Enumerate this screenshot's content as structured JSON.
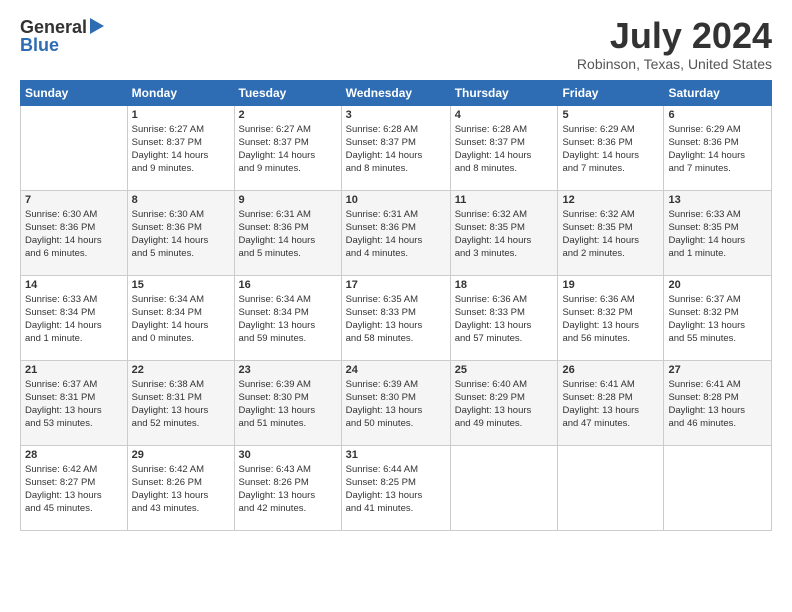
{
  "header": {
    "logo_general": "General",
    "logo_blue": "Blue",
    "month_title": "July 2024",
    "location": "Robinson, Texas, United States"
  },
  "calendar": {
    "columns": [
      "Sunday",
      "Monday",
      "Tuesday",
      "Wednesday",
      "Thursday",
      "Friday",
      "Saturday"
    ],
    "weeks": [
      [
        {
          "num": "",
          "info": ""
        },
        {
          "num": "1",
          "info": "Sunrise: 6:27 AM\nSunset: 8:37 PM\nDaylight: 14 hours\nand 9 minutes."
        },
        {
          "num": "2",
          "info": "Sunrise: 6:27 AM\nSunset: 8:37 PM\nDaylight: 14 hours\nand 9 minutes."
        },
        {
          "num": "3",
          "info": "Sunrise: 6:28 AM\nSunset: 8:37 PM\nDaylight: 14 hours\nand 8 minutes."
        },
        {
          "num": "4",
          "info": "Sunrise: 6:28 AM\nSunset: 8:37 PM\nDaylight: 14 hours\nand 8 minutes."
        },
        {
          "num": "5",
          "info": "Sunrise: 6:29 AM\nSunset: 8:36 PM\nDaylight: 14 hours\nand 7 minutes."
        },
        {
          "num": "6",
          "info": "Sunrise: 6:29 AM\nSunset: 8:36 PM\nDaylight: 14 hours\nand 7 minutes."
        }
      ],
      [
        {
          "num": "7",
          "info": "Sunrise: 6:30 AM\nSunset: 8:36 PM\nDaylight: 14 hours\nand 6 minutes."
        },
        {
          "num": "8",
          "info": "Sunrise: 6:30 AM\nSunset: 8:36 PM\nDaylight: 14 hours\nand 5 minutes."
        },
        {
          "num": "9",
          "info": "Sunrise: 6:31 AM\nSunset: 8:36 PM\nDaylight: 14 hours\nand 5 minutes."
        },
        {
          "num": "10",
          "info": "Sunrise: 6:31 AM\nSunset: 8:36 PM\nDaylight: 14 hours\nand 4 minutes."
        },
        {
          "num": "11",
          "info": "Sunrise: 6:32 AM\nSunset: 8:35 PM\nDaylight: 14 hours\nand 3 minutes."
        },
        {
          "num": "12",
          "info": "Sunrise: 6:32 AM\nSunset: 8:35 PM\nDaylight: 14 hours\nand 2 minutes."
        },
        {
          "num": "13",
          "info": "Sunrise: 6:33 AM\nSunset: 8:35 PM\nDaylight: 14 hours\nand 1 minute."
        }
      ],
      [
        {
          "num": "14",
          "info": "Sunrise: 6:33 AM\nSunset: 8:34 PM\nDaylight: 14 hours\nand 1 minute."
        },
        {
          "num": "15",
          "info": "Sunrise: 6:34 AM\nSunset: 8:34 PM\nDaylight: 14 hours\nand 0 minutes."
        },
        {
          "num": "16",
          "info": "Sunrise: 6:34 AM\nSunset: 8:34 PM\nDaylight: 13 hours\nand 59 minutes."
        },
        {
          "num": "17",
          "info": "Sunrise: 6:35 AM\nSunset: 8:33 PM\nDaylight: 13 hours\nand 58 minutes."
        },
        {
          "num": "18",
          "info": "Sunrise: 6:36 AM\nSunset: 8:33 PM\nDaylight: 13 hours\nand 57 minutes."
        },
        {
          "num": "19",
          "info": "Sunrise: 6:36 AM\nSunset: 8:32 PM\nDaylight: 13 hours\nand 56 minutes."
        },
        {
          "num": "20",
          "info": "Sunrise: 6:37 AM\nSunset: 8:32 PM\nDaylight: 13 hours\nand 55 minutes."
        }
      ],
      [
        {
          "num": "21",
          "info": "Sunrise: 6:37 AM\nSunset: 8:31 PM\nDaylight: 13 hours\nand 53 minutes."
        },
        {
          "num": "22",
          "info": "Sunrise: 6:38 AM\nSunset: 8:31 PM\nDaylight: 13 hours\nand 52 minutes."
        },
        {
          "num": "23",
          "info": "Sunrise: 6:39 AM\nSunset: 8:30 PM\nDaylight: 13 hours\nand 51 minutes."
        },
        {
          "num": "24",
          "info": "Sunrise: 6:39 AM\nSunset: 8:30 PM\nDaylight: 13 hours\nand 50 minutes."
        },
        {
          "num": "25",
          "info": "Sunrise: 6:40 AM\nSunset: 8:29 PM\nDaylight: 13 hours\nand 49 minutes."
        },
        {
          "num": "26",
          "info": "Sunrise: 6:41 AM\nSunset: 8:28 PM\nDaylight: 13 hours\nand 47 minutes."
        },
        {
          "num": "27",
          "info": "Sunrise: 6:41 AM\nSunset: 8:28 PM\nDaylight: 13 hours\nand 46 minutes."
        }
      ],
      [
        {
          "num": "28",
          "info": "Sunrise: 6:42 AM\nSunset: 8:27 PM\nDaylight: 13 hours\nand 45 minutes."
        },
        {
          "num": "29",
          "info": "Sunrise: 6:42 AM\nSunset: 8:26 PM\nDaylight: 13 hours\nand 43 minutes."
        },
        {
          "num": "30",
          "info": "Sunrise: 6:43 AM\nSunset: 8:26 PM\nDaylight: 13 hours\nand 42 minutes."
        },
        {
          "num": "31",
          "info": "Sunrise: 6:44 AM\nSunset: 8:25 PM\nDaylight: 13 hours\nand 41 minutes."
        },
        {
          "num": "",
          "info": ""
        },
        {
          "num": "",
          "info": ""
        },
        {
          "num": "",
          "info": ""
        }
      ]
    ]
  }
}
